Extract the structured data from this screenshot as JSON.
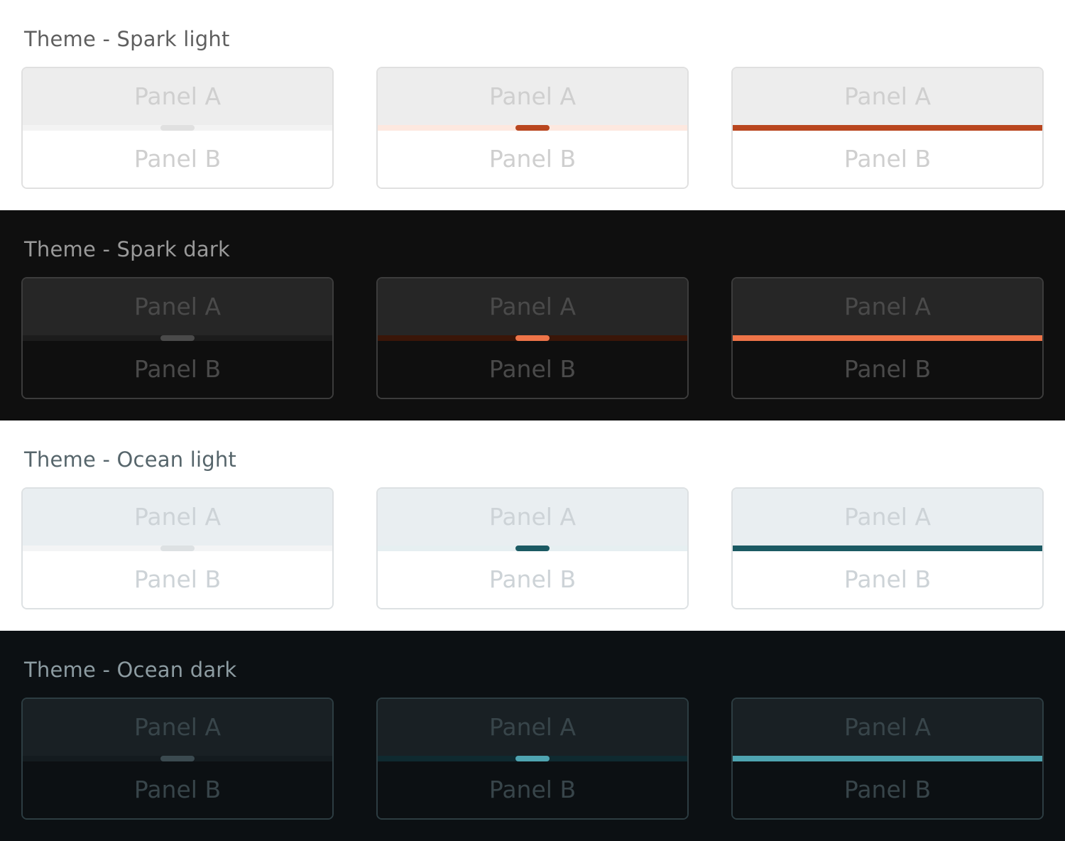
{
  "themes": [
    {
      "title": "Theme - Spark light",
      "colors": {
        "bg": "#ffffff",
        "title": "#5f5f5f",
        "border": "#e0e0e0",
        "panelA": "#ededed",
        "panelB": "#ffffff",
        "text": "#cfcfcf",
        "divIdle": "#f3f3f3",
        "handleIdle": "#e0e0e0",
        "divHover": "#fde8df",
        "accent": "#b9461f"
      },
      "panels": [
        {
          "a": "Panel A",
          "b": "Panel B"
        },
        {
          "a": "Panel A",
          "b": "Panel B"
        },
        {
          "a": "Panel A",
          "b": "Panel B"
        }
      ]
    },
    {
      "title": "Theme - Spark dark",
      "colors": {
        "bg": "#0f0f0f",
        "title": "#9a9a9a",
        "border": "#3c3c3c",
        "panelA": "#262626",
        "panelB": "#0f0f0f",
        "text": "#4a4a4a",
        "divIdle": "#1c1c1c",
        "handleIdle": "#4a4a4a",
        "divHover": "#3a1608",
        "accent": "#ee7448"
      },
      "panels": [
        {
          "a": "Panel A",
          "b": "Panel B"
        },
        {
          "a": "Panel A",
          "b": "Panel B"
        },
        {
          "a": "Panel A",
          "b": "Panel B"
        }
      ]
    },
    {
      "title": "Theme - Ocean light",
      "colors": {
        "bg": "#ffffff",
        "title": "#56656b",
        "border": "#dde1e3",
        "panelA": "#e9eef1",
        "panelB": "#ffffff",
        "text": "#cdd3d7",
        "divIdle": "#f3f4f5",
        "handleIdle": "#dde1e3",
        "divHover": "#e6eff1",
        "accent": "#1b5a63"
      },
      "panels": [
        {
          "a": "Panel A",
          "b": "Panel B"
        },
        {
          "a": "Panel A",
          "b": "Panel B"
        },
        {
          "a": "Panel A",
          "b": "Panel B"
        }
      ]
    },
    {
      "title": "Theme - Ocean dark",
      "colors": {
        "bg": "#0c1013",
        "title": "#8d9ca2",
        "border": "#2d3d42",
        "panelA": "#192024",
        "panelB": "#0c1013",
        "text": "#38454a",
        "divIdle": "#141b1f",
        "handleIdle": "#3b4a50",
        "divHover": "#0f2a30",
        "accent": "#4fa4b1"
      },
      "panels": [
        {
          "a": "Panel A",
          "b": "Panel B"
        },
        {
          "a": "Panel A",
          "b": "Panel B"
        },
        {
          "a": "Panel A",
          "b": "Panel B"
        }
      ]
    }
  ]
}
